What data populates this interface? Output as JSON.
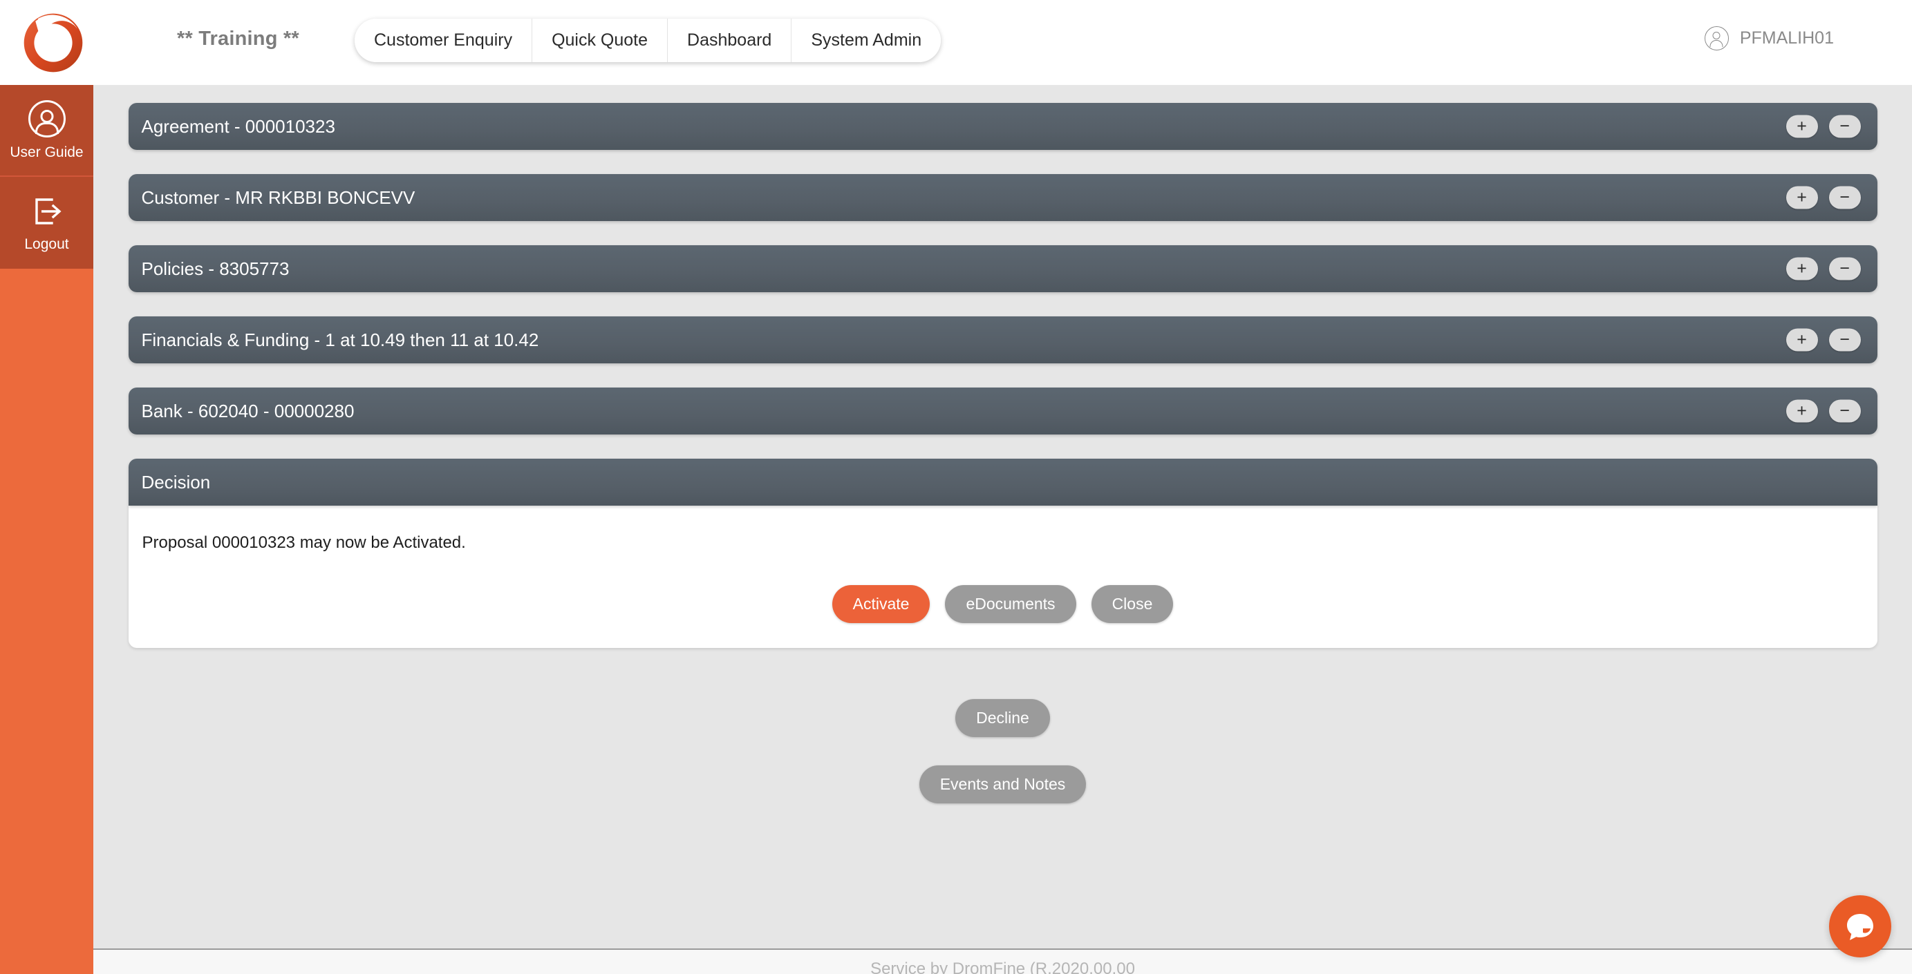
{
  "header": {
    "logo_icon": "brand-ring-logo",
    "title": "** Training **",
    "tabs": [
      {
        "label": "Customer Enquiry"
      },
      {
        "label": "Quick Quote"
      },
      {
        "label": "Dashboard"
      },
      {
        "label": "System Admin"
      }
    ],
    "user": {
      "icon": "user-circle-icon",
      "name": "PFMALIH01"
    }
  },
  "sidebar": {
    "items": [
      {
        "label": "User Guide",
        "icon": "user-circle-icon"
      },
      {
        "label": "Logout",
        "icon": "logout-door-arrow-icon"
      }
    ]
  },
  "panels": [
    {
      "title": "Agreement - 000010323",
      "expand": "+",
      "collapse": "−"
    },
    {
      "title": "Customer - MR RKBBI BONCEVV",
      "expand": "+",
      "collapse": "−"
    },
    {
      "title": "Policies - 8305773",
      "expand": "+",
      "collapse": "−"
    },
    {
      "title": "Financials & Funding - 1 at 10.49 then 11 at 10.42",
      "expand": "+",
      "collapse": "−"
    },
    {
      "title": "Bank - 602040 - 00000280",
      "expand": "+",
      "collapse": "−"
    }
  ],
  "decision": {
    "title": "Decision",
    "message": "Proposal 000010323 may now be Activated.",
    "actions": [
      {
        "label": "Activate",
        "style": "primary"
      },
      {
        "label": "eDocuments",
        "style": "grey"
      },
      {
        "label": "Close",
        "style": "grey"
      }
    ]
  },
  "page_actions": [
    {
      "label": "Decline"
    },
    {
      "label": "Events and Notes"
    }
  ],
  "footer": {
    "text": "Service by DromFine (R.2020.00.00"
  },
  "chat": {
    "icon": "chat-bubble-icon"
  },
  "colors": {
    "brand_orange": "#ec6a3c",
    "sidebar_item": "#b5492a",
    "panel_header": "#565f68",
    "primary_button": "#ec6239",
    "grey_button": "#9b9b9b",
    "page_background": "#e6e6e6"
  }
}
